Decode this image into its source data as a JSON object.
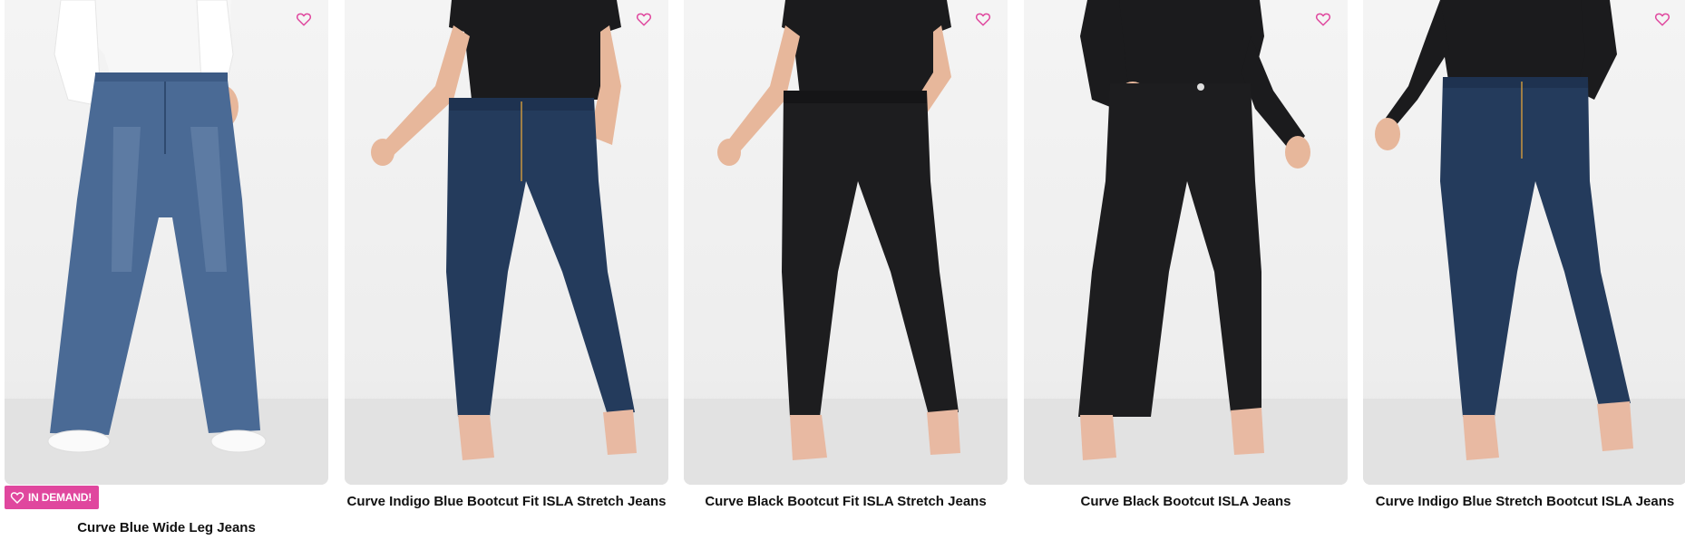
{
  "colors": {
    "accent_pink": "#e0479e",
    "title_text": "#111111",
    "image_bg": "#efefef",
    "denim_light": "#4a6a95",
    "denim_indigo": "#243b5c",
    "black_denim": "#1d1d1f",
    "skin": "#e7b79b",
    "top_black": "#1b1b1d",
    "top_white": "#f7f7f7"
  },
  "products": [
    {
      "title": "Curve Blue Wide Leg Jeans",
      "badge": "IN DEMAND!",
      "wishlist_icon": "heart-outline-icon"
    },
    {
      "title": "Curve Indigo Blue Bootcut Fit ISLA Stretch Jeans",
      "wishlist_icon": "heart-outline-icon"
    },
    {
      "title": "Curve Black Bootcut Fit ISLA Stretch Jeans",
      "wishlist_icon": "heart-outline-icon"
    },
    {
      "title": "Curve Black Bootcut ISLA Jeans",
      "wishlist_icon": "heart-outline-icon"
    },
    {
      "title": "Curve Indigo Blue Stretch Bootcut ISLA Jeans",
      "wishlist_icon": "heart-outline-icon"
    }
  ]
}
